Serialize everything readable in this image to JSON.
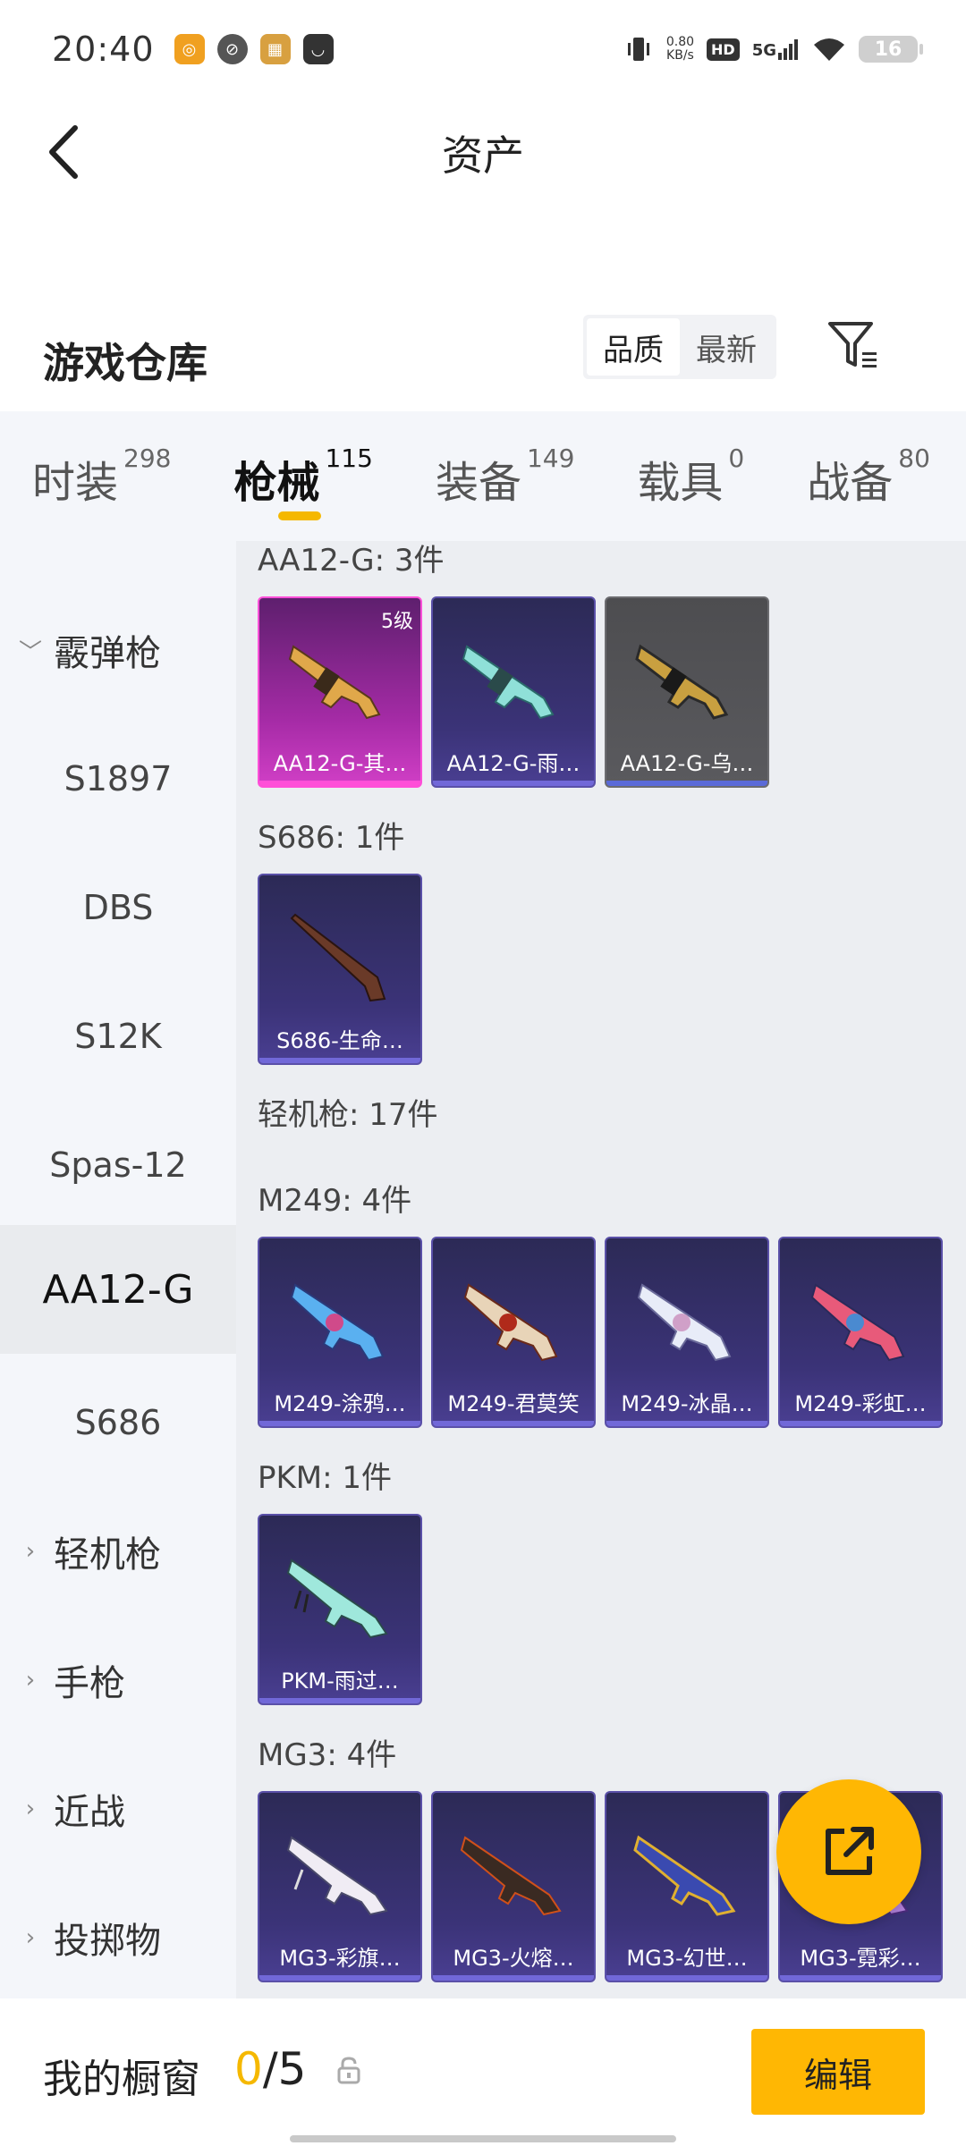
{
  "status_bar": {
    "time": "20:40",
    "net_speed_value": "0.80",
    "net_speed_unit": "KB/s",
    "hd_label": "HD",
    "network_label": "5G",
    "battery_level": "16"
  },
  "header": {
    "title": "资产"
  },
  "warehouse": {
    "title": "游戏仓库",
    "sort_quality": "品质",
    "sort_latest": "最新"
  },
  "tabs": [
    {
      "label": "时装",
      "count": "298"
    },
    {
      "label": "枪械",
      "count": "115"
    },
    {
      "label": "装备",
      "count": "149"
    },
    {
      "label": "载具",
      "count": "0"
    },
    {
      "label": "战备",
      "count": "80"
    }
  ],
  "sidebar": {
    "items": [
      {
        "label": "霰弹枪"
      },
      {
        "label": "S1897"
      },
      {
        "label": "DBS"
      },
      {
        "label": "S12K"
      },
      {
        "label": "Spas-12"
      },
      {
        "label": "AA12-G"
      },
      {
        "label": "S686"
      },
      {
        "label": "轻机枪"
      },
      {
        "label": "手枪"
      },
      {
        "label": "近战"
      },
      {
        "label": "投掷物"
      }
    ]
  },
  "sections": {
    "aa12g": {
      "title": "AA12-G: 3件"
    },
    "s686": {
      "title": "S686: 1件"
    },
    "lmg": {
      "title": "轻机枪: 17件"
    },
    "m249": {
      "title": "M249: 4件"
    },
    "pkm": {
      "title": "PKM: 1件"
    },
    "mg3": {
      "title": "MG3: 4件"
    }
  },
  "cards": {
    "aa12g_1": {
      "name": "AA12-G-其…",
      "level": "5级"
    },
    "aa12g_2": {
      "name": "AA12-G-雨…"
    },
    "aa12g_3": {
      "name": "AA12-G-乌…"
    },
    "s686_1": {
      "name": "S686-生命…"
    },
    "m249_1": {
      "name": "M249-涂鸦…"
    },
    "m249_2": {
      "name": "M249-君莫笑"
    },
    "m249_3": {
      "name": "M249-冰晶…"
    },
    "m249_4": {
      "name": "M249-彩虹…"
    },
    "pkm_1": {
      "name": "PKM-雨过…"
    },
    "mg3_1": {
      "name": "MG3-彩旗…"
    },
    "mg3_2": {
      "name": "MG3-火熔…"
    },
    "mg3_3": {
      "name": "MG3-幻世…"
    },
    "mg3_4": {
      "name": "MG3-霓彩…"
    }
  },
  "bottom": {
    "showcase_label": "我的橱窗",
    "showcase_current": "0",
    "showcase_total": "/5",
    "edit_label": "编辑"
  },
  "colors": {
    "accent": "#ffb703",
    "tab_indicator": "#f5b800",
    "card_purple": "#3b3378",
    "card_pink": "#d13fc6",
    "card_grey": "#5a5a5e"
  }
}
